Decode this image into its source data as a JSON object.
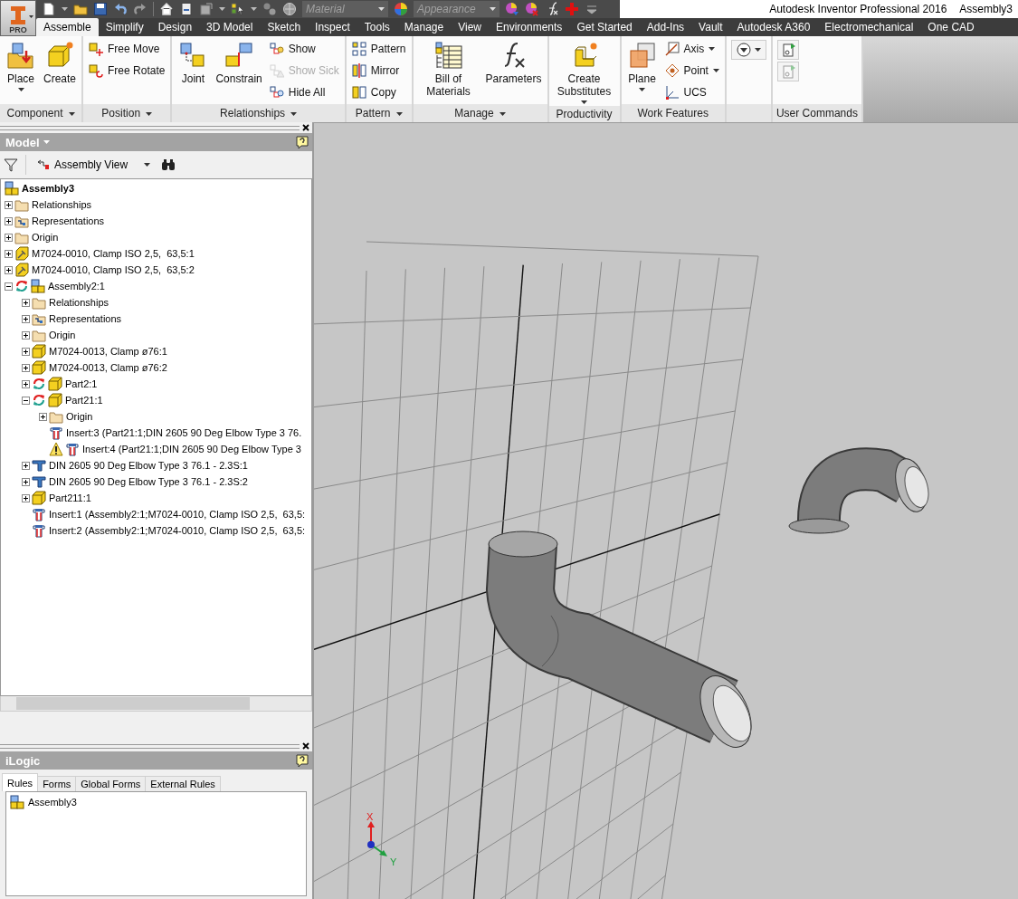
{
  "app_menu": {
    "label": "PRO"
  },
  "quick_access": {
    "material": "Material",
    "appearance": "Appearance"
  },
  "window": {
    "title": "Autodesk Inventor Professional 2016",
    "document": "Assembly3"
  },
  "tabs": [
    {
      "label": "Assemble",
      "selected": true
    },
    {
      "label": "Simplify",
      "selected": false
    },
    {
      "label": "Design",
      "selected": false
    },
    {
      "label": "3D Model",
      "selected": false
    },
    {
      "label": "Sketch",
      "selected": false
    },
    {
      "label": "Inspect",
      "selected": false
    },
    {
      "label": "Tools",
      "selected": false
    },
    {
      "label": "Manage",
      "selected": false
    },
    {
      "label": "View",
      "selected": false
    },
    {
      "label": "Environments",
      "selected": false
    },
    {
      "label": "Get Started",
      "selected": false
    },
    {
      "label": "Add-Ins",
      "selected": false
    },
    {
      "label": "Vault",
      "selected": false
    },
    {
      "label": "Autodesk A360",
      "selected": false
    },
    {
      "label": "Electromechanical",
      "selected": false
    },
    {
      "label": "One CAD",
      "selected": false
    }
  ],
  "ribbon_panels": [
    {
      "label": "Component",
      "has_menu": true,
      "tools": [
        {
          "kind": "large",
          "label": "Place",
          "dropdown": true,
          "disabled": false
        },
        {
          "kind": "large",
          "label": "Create",
          "dropdown": false,
          "disabled": false
        }
      ]
    },
    {
      "label": "Position",
      "has_menu": true,
      "tools": [
        {
          "kind": "small",
          "label": "Free Move",
          "dropdown": false,
          "disabled": false
        },
        {
          "kind": "small",
          "label": "Free Rotate",
          "dropdown": false,
          "disabled": false
        }
      ]
    },
    {
      "label": "Relationships",
      "has_menu": true,
      "tools": [
        {
          "kind": "large",
          "label": "Joint",
          "dropdown": false,
          "disabled": false
        },
        {
          "kind": "large",
          "label": "Constrain",
          "dropdown": false,
          "disabled": false
        },
        {
          "kind": "small",
          "label": "Show",
          "dropdown": false,
          "disabled": false
        },
        {
          "kind": "small",
          "label": "Show Sick",
          "dropdown": false,
          "disabled": true
        },
        {
          "kind": "small",
          "label": "Hide All",
          "dropdown": false,
          "disabled": false
        }
      ]
    },
    {
      "label": "Pattern",
      "has_menu": true,
      "tools": [
        {
          "kind": "small",
          "label": "Pattern",
          "dropdown": false,
          "disabled": false
        },
        {
          "kind": "small",
          "label": "Mirror",
          "dropdown": false,
          "disabled": false
        },
        {
          "kind": "small",
          "label": "Copy",
          "dropdown": false,
          "disabled": false
        }
      ]
    },
    {
      "label": "Manage",
      "has_menu": true,
      "tools": [
        {
          "kind": "large",
          "label": "Bill of Materials",
          "dropdown": false,
          "disabled": false
        },
        {
          "kind": "large",
          "label": "Parameters",
          "dropdown": false,
          "disabled": false
        }
      ]
    },
    {
      "label": "Productivity",
      "has_menu": false,
      "tools": [
        {
          "kind": "large",
          "label": "Create Substitutes",
          "dropdown": true,
          "disabled": false
        }
      ]
    },
    {
      "label": "Work Features",
      "has_menu": false,
      "tools": [
        {
          "kind": "large",
          "label": "Plane",
          "dropdown": true,
          "disabled": false
        },
        {
          "kind": "small",
          "label": "Axis",
          "dropdown": true,
          "disabled": false
        },
        {
          "kind": "small",
          "label": "Point",
          "dropdown": true,
          "disabled": false
        },
        {
          "kind": "small",
          "label": "UCS",
          "dropdown": false,
          "disabled": false
        }
      ]
    },
    {
      "has_menu": false,
      "tools": [
        {
          "kind": "icon",
          "dropdown": true,
          "disabled": false
        }
      ]
    },
    {
      "label": "User Commands",
      "has_menu": false,
      "tools": [
        {
          "kind": "icon",
          "dropdown": false,
          "disabled": false
        },
        {
          "kind": "icon",
          "dropdown": false,
          "disabled": true
        }
      ]
    }
  ],
  "model_browser": {
    "title": "Model",
    "view": "Assembly View",
    "root": {
      "label": "Assembly3",
      "kind": "assembly",
      "children": [
        {
          "label": "Relationships",
          "kind": "folder",
          "expanded": false,
          "needs_update": false,
          "warning": false
        },
        {
          "label": "Representations",
          "kind": "representations",
          "expanded": false,
          "needs_update": false,
          "warning": false
        },
        {
          "label": "Origin",
          "kind": "folder",
          "expanded": false,
          "needs_update": false,
          "warning": false
        },
        {
          "label": "M7024-0010, Clamp ISO 2,5,  63,5:1",
          "kind": "clamp",
          "expanded": false,
          "needs_update": false,
          "warning": false
        },
        {
          "label": "M7024-0010, Clamp ISO 2,5,  63,5:2",
          "kind": "clamp",
          "expanded": false,
          "needs_update": false,
          "warning": false
        },
        {
          "label": "Assembly2:1",
          "kind": "assembly",
          "expanded": true,
          "needs_update": true,
          "warning": false,
          "children": [
            {
              "label": "Relationships",
              "kind": "folder",
              "expanded": false,
              "needs_update": false,
              "warning": false
            },
            {
              "label": "Representations",
              "kind": "representations",
              "expanded": false,
              "needs_update": false,
              "warning": false
            },
            {
              "label": "Origin",
              "kind": "folder",
              "expanded": false,
              "needs_update": false,
              "warning": false
            },
            {
              "label": "M7024-0013, Clamp ø76:1",
              "kind": "part",
              "expanded": false,
              "needs_update": false,
              "warning": false
            },
            {
              "label": "M7024-0013, Clamp ø76:2",
              "kind": "part",
              "expanded": false,
              "needs_update": false,
              "warning": false
            },
            {
              "label": "Part2:1",
              "kind": "part",
              "expanded": false,
              "needs_update": true,
              "warning": false
            },
            {
              "label": "Part21:1",
              "kind": "part",
              "expanded": true,
              "needs_update": true,
              "warning": false,
              "children": [
                {
                  "label": "Origin",
                  "kind": "folder",
                  "expanded": false,
                  "needs_update": false,
                  "warning": false
                },
                {
                  "label": "Insert:3 (Part21:1;DIN 2605 90 Deg Elbow Type 3 76.",
                  "kind": "insert",
                  "needs_update": false,
                  "warning": false
                },
                {
                  "label": "Insert:4 (Part21:1;DIN 2605 90 Deg Elbow Type 3",
                  "kind": "insert",
                  "needs_update": false,
                  "warning": true
                }
              ]
            },
            {
              "label": "DIN 2605 90 Deg Elbow Type 3 76.1 - 2.3S:1",
              "kind": "elbow",
              "expanded": false,
              "needs_update": false,
              "warning": false
            },
            {
              "label": "DIN 2605 90 Deg Elbow Type 3 76.1 - 2.3S:2",
              "kind": "elbow",
              "expanded": false,
              "needs_update": false,
              "warning": false
            },
            {
              "label": "Part211:1",
              "kind": "part",
              "expanded": false,
              "needs_update": false,
              "warning": false
            },
            {
              "label": "Insert:1 (Assembly2:1;M7024-0010, Clamp ISO 2,5,  63,5:",
              "kind": "insert",
              "needs_update": false,
              "warning": false
            },
            {
              "label": "Insert:2 (Assembly2:1;M7024-0010, Clamp ISO 2,5,  63,5:",
              "kind": "insert",
              "needs_update": false,
              "warning": false
            }
          ]
        }
      ]
    }
  },
  "ilogic": {
    "title": "iLogic",
    "tabs": [
      {
        "label": "Rules",
        "selected": true
      },
      {
        "label": "Forms",
        "selected": false
      },
      {
        "label": "Global Forms",
        "selected": false
      },
      {
        "label": "External Rules",
        "selected": false
      }
    ],
    "rules": [
      {
        "label": "Assembly3"
      }
    ]
  },
  "viewport": {
    "triad": {
      "x": "X",
      "y": "Y"
    }
  }
}
